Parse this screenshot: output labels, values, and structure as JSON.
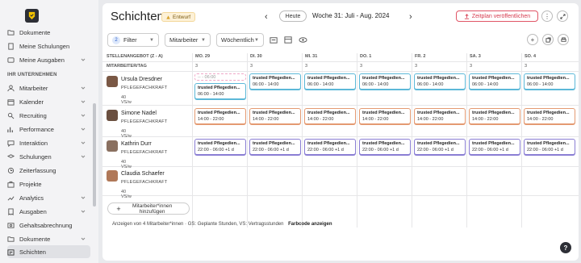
{
  "sidebar": {
    "section_header": "IHR UNTERNEHMEN",
    "top_items": [
      {
        "label": "Dokumente",
        "icon": "folder-icon"
      },
      {
        "label": "Meine Schulungen",
        "icon": "book-icon"
      },
      {
        "label": "Meine Ausgaben",
        "icon": "wallet-icon"
      }
    ],
    "items": [
      {
        "label": "Mitarbeiter",
        "icon": "users-icon",
        "chevron": true
      },
      {
        "label": "Kalender",
        "icon": "calendar-icon",
        "chevron": true
      },
      {
        "label": "Recruiting",
        "icon": "person-search-icon",
        "chevron": true
      },
      {
        "label": "Performance",
        "icon": "chart-icon",
        "chevron": true
      },
      {
        "label": "Interaktion",
        "icon": "chat-icon",
        "chevron": true
      },
      {
        "label": "Schulungen",
        "icon": "graduation-icon",
        "chevron": true
      },
      {
        "label": "Zeiterfassung",
        "icon": "clock-icon",
        "chevron": false
      },
      {
        "label": "Projekte",
        "icon": "briefcase-icon",
        "chevron": false
      },
      {
        "label": "Analytics",
        "icon": "analytics-icon",
        "chevron": true
      },
      {
        "label": "Ausgaben",
        "icon": "receipt-icon",
        "chevron": true
      },
      {
        "label": "Gehaltsabrechnung",
        "icon": "payroll-icon",
        "chevron": false
      },
      {
        "label": "Dokumente",
        "icon": "folder-icon",
        "chevron": true
      },
      {
        "label": "Schichten",
        "icon": "shifts-icon",
        "chevron": false,
        "active": true
      }
    ]
  },
  "header": {
    "title": "Schichten",
    "badge": "Entwurf",
    "today_label": "Heute",
    "week_label": "Woche 31: Juli - Aug. 2024",
    "publish_label": "Zeitplan veröffentlichen"
  },
  "toolbar": {
    "filter_label": "Filter",
    "filter_count": "2",
    "group_label": "Mitarbeiter",
    "period_label": "Wöchentlich"
  },
  "grid": {
    "sort_header": "STELLENANGEBOT (Z - A)",
    "sub_header": "MITARBEITER/TAG",
    "days": [
      {
        "label": "MO. 29",
        "count": "3"
      },
      {
        "label": "DI. 30",
        "count": "3"
      },
      {
        "label": "MI. 31",
        "count": "3"
      },
      {
        "label": "DO. 1",
        "count": "3"
      },
      {
        "label": "FR. 2",
        "count": "3"
      },
      {
        "label": "SA. 3",
        "count": "3"
      },
      {
        "label": "SO. 4",
        "count": "3"
      }
    ],
    "employees": [
      {
        "name": "Ursula Dresdner",
        "role": "PFLEGEFACHKRAFT",
        "hours": "40 VS/w"
      },
      {
        "name": "Simone Nadel",
        "role": "PFLEGEFACHKRAFT",
        "hours": "40 VS/w"
      },
      {
        "name": "Kathrin Durr",
        "role": "PFLEGEFACHKRAFT",
        "hours": "40 VS/w"
      },
      {
        "name": "Claudia Schaefer",
        "role": "PFLEGEFACHKRAFT",
        "hours": "40 VS/w"
      }
    ],
    "shift_title": "trusted Pflegedien...",
    "shift_early": "06:00 - 14:00",
    "shift_late": "14:00 - 22:00",
    "shift_night": "22:00 - 06:00 +1 d",
    "shift_placeholder": "-- - 06:00",
    "add_employee_label": "Mitarbeiter*innen hinzufügen"
  },
  "footer": {
    "text": "Anzeigen von 4 Mitarbeiter*innen · GS: Geplante Stunden, VS: Vertragsstunden",
    "link": "Farbcode anzeigen"
  },
  "colors": {
    "early": "#5cb8d8",
    "late": "#e49a72",
    "night": "#8a7ed4",
    "publish": "#d63a4e"
  }
}
